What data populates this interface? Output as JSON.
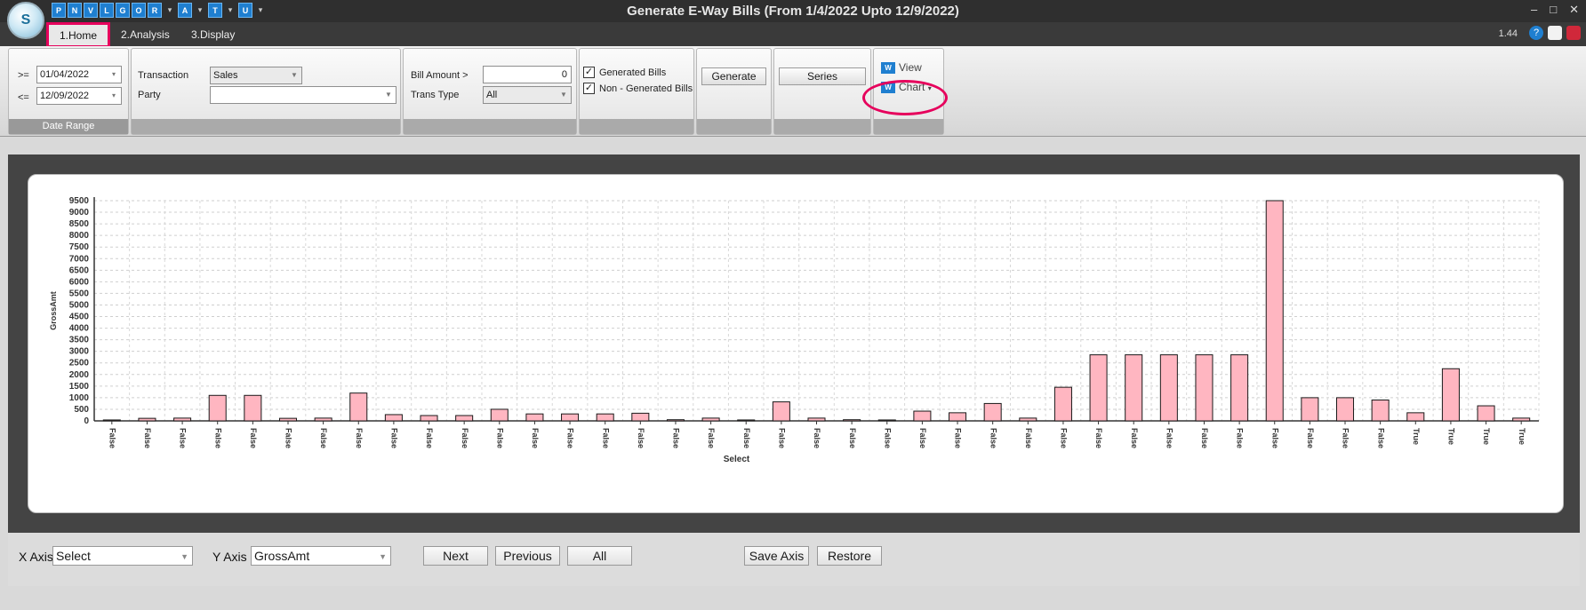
{
  "window": {
    "title": "Generate E-Way Bills (From 1/4/2022 Upto 12/9/2022)",
    "logo_text": "S",
    "version": "1.44",
    "controls": [
      "–",
      "□",
      "✕"
    ]
  },
  "quick_access": [
    "P",
    "N",
    "V",
    "L",
    "G",
    "O",
    "R",
    "A",
    "T",
    "U"
  ],
  "tabs": [
    {
      "label": "1.Home",
      "active": true
    },
    {
      "label": "2.Analysis",
      "active": false
    },
    {
      "label": "3.Display",
      "active": false
    }
  ],
  "ribbon": {
    "date_range": {
      "from_op": ">=",
      "from_value": "01/04/2022",
      "to_op": "<=",
      "to_value": "12/09/2022",
      "footer": "Date Range"
    },
    "transaction": {
      "label": "Transaction",
      "value": "Sales"
    },
    "party": {
      "label": "Party",
      "value": ""
    },
    "bill_amount": {
      "label": "Bill Amount >",
      "value": "0"
    },
    "trans_type": {
      "label": "Trans Type",
      "value": "All"
    },
    "generated_bills": {
      "label": "Generated Bills",
      "checked": true
    },
    "non_generated_bills": {
      "label": "Non - Generated Bills",
      "checked": true
    },
    "generate_label": "Generate",
    "series_label": "Series",
    "view_label": "View",
    "chart_label": "Chart",
    "icon_text": "W"
  },
  "chart_data": {
    "type": "bar",
    "xlabel": "Select",
    "ylabel": "GrossAmt",
    "ylim": [
      0,
      9500
    ],
    "yticks": [
      0,
      500,
      1000,
      1500,
      2000,
      2500,
      3000,
      3500,
      4000,
      4500,
      5000,
      5500,
      6000,
      6500,
      7000,
      7500,
      8000,
      8500,
      9000,
      9500
    ],
    "grid": true,
    "categories": [
      "False",
      "False",
      "False",
      "False",
      "False",
      "False",
      "False",
      "False",
      "False",
      "False",
      "False",
      "False",
      "False",
      "False",
      "False",
      "False",
      "False",
      "False",
      "False",
      "False",
      "False",
      "False",
      "False",
      "False",
      "False",
      "False",
      "False",
      "False",
      "False",
      "False",
      "False",
      "False",
      "False",
      "False",
      "False",
      "False",
      "False",
      "True",
      "True",
      "True",
      "True"
    ],
    "values": [
      40,
      110,
      120,
      1100,
      1100,
      110,
      120,
      1200,
      270,
      230,
      230,
      500,
      300,
      300,
      300,
      330,
      50,
      120,
      40,
      820,
      120,
      50,
      40,
      420,
      350,
      750,
      120,
      1450,
      2850,
      2850,
      2850,
      2850,
      2850,
      9500,
      1000,
      1000,
      900,
      350,
      2250,
      650,
      120
    ],
    "bar_color": "#ffb6c1"
  },
  "bottom": {
    "x_axis_label": "X Axis",
    "x_axis_value": "Select",
    "y_axis_label": "Y Axis",
    "y_axis_value": "GrossAmt",
    "next_label": "Next",
    "previous_label": "Previous",
    "all_label": "All",
    "save_axis_label": "Save Axis",
    "restore_label": "Restore"
  }
}
